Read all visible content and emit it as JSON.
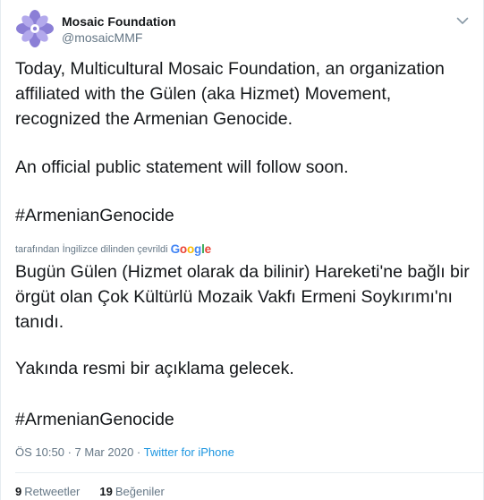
{
  "account": {
    "display_name": "Mosaic Foundation",
    "handle": "@mosaicMMF",
    "avatar_icon": "flower-logo-icon"
  },
  "tweet": {
    "original_paragraph_1": "Today, Multicultural Mosaic Foundation, an organization affiliated with the Gülen (aka Hizmet) Movement, recognized the Armenian Genocide.",
    "original_paragraph_2": "An official public statement will follow soon.",
    "original_hashtag": "#ArmenianGenocide",
    "translation_label": "tarafından İngilizce dilinden çevrildi",
    "translation_provider": "Google",
    "translated_paragraph_1": "Bugün Gülen (Hizmet olarak da bilinir) Hareketi'ne bağlı bir örgüt olan Çok Kültürlü Mozaik Vakfı Ermeni Soykırımı'nı tanıdı.",
    "translated_paragraph_2": " Yakında resmi bir açıklama gelecek.",
    "translated_hashtag": "#ArmenianGenocide"
  },
  "meta": {
    "time": "ÖS 10:50",
    "date": "7 Mar 2020",
    "separator": "·",
    "source": "Twitter for iPhone"
  },
  "stats": {
    "retweets_count": "9",
    "retweets_label": "Retweetler",
    "likes_count": "19",
    "likes_label": "Beğeniler"
  },
  "colors": {
    "link": "#1b95e0",
    "secondary_text": "#657786",
    "primary_text": "#14171a",
    "logo_purple": "#7b6fc4"
  }
}
